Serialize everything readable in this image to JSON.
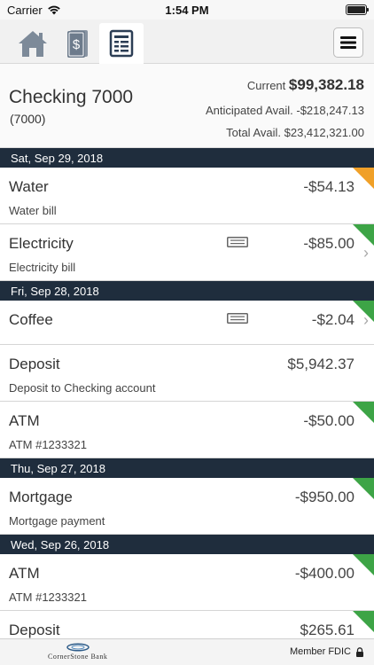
{
  "status_bar": {
    "carrier": "Carrier",
    "time": "1:54 PM"
  },
  "nav": {
    "tabs": [
      {
        "icon": "home-icon"
      },
      {
        "icon": "money-icon"
      },
      {
        "icon": "statement-icon",
        "active": true
      }
    ],
    "menu_icon": "hamburger-icon"
  },
  "account": {
    "name": "Checking 7000",
    "number": "(7000)",
    "current_label": "Current",
    "current_amount": "$99,382.18",
    "anticipated": "Anticipated Avail. -$218,247.13",
    "total": "Total Avail. $23,412,321.00"
  },
  "groups": [
    {
      "date": "Sat, Sep 29, 2018",
      "transactions": [
        {
          "name": "Water",
          "desc": "Water bill",
          "amount": "-$54.13",
          "status": "pending",
          "memo": false,
          "chevron": false
        },
        {
          "name": "Electricity",
          "desc": "Electricity bill",
          "amount": "-$85.00",
          "status": "cleared",
          "memo": true,
          "chevron": true
        }
      ]
    },
    {
      "date": "Fri, Sep 28, 2018",
      "transactions": [
        {
          "name": "Coffee",
          "desc": "",
          "amount": "-$2.04",
          "status": "cleared",
          "memo": true,
          "chevron": true
        },
        {
          "name": "Deposit",
          "desc": "Deposit to Checking account",
          "amount": "$5,942.37",
          "status": "none",
          "memo": false,
          "chevron": false
        },
        {
          "name": "ATM",
          "desc": "ATM #1233321",
          "amount": "-$50.00",
          "status": "cleared",
          "memo": false,
          "chevron": false
        }
      ]
    },
    {
      "date": "Thu, Sep 27, 2018",
      "transactions": [
        {
          "name": "Mortgage",
          "desc": "Mortgage payment",
          "amount": "-$950.00",
          "status": "cleared",
          "memo": false,
          "chevron": false
        }
      ]
    },
    {
      "date": "Wed, Sep 26, 2018",
      "transactions": [
        {
          "name": "ATM",
          "desc": "ATM #1233321",
          "amount": "-$400.00",
          "status": "cleared",
          "memo": false,
          "chevron": false
        },
        {
          "name": "Deposit",
          "desc": "",
          "amount": "$265.61",
          "status": "cleared",
          "memo": false,
          "chevron": false
        }
      ]
    }
  ],
  "footer": {
    "bank_name": "CornerStone Bank",
    "fdic": "Member FDIC",
    "lock_icon": "lock-icon"
  },
  "colors": {
    "header_bg": "#1f2d3d",
    "cleared": "#3da446",
    "pending": "#f0a028",
    "active_tab_icon": "#2c3e55"
  }
}
